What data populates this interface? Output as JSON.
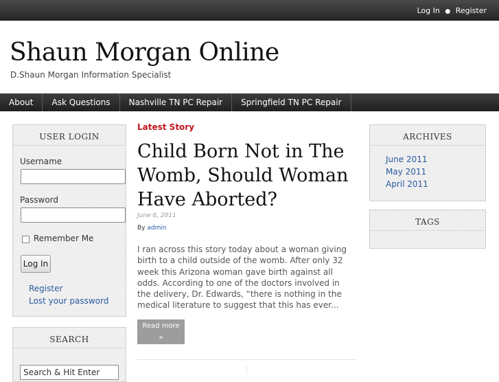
{
  "topbar": {
    "login": "Log In",
    "separator": "●",
    "register": "Register"
  },
  "site": {
    "title": "Shaun Morgan Online",
    "tagline": "D.Shaun Morgan Information Specialist"
  },
  "nav": [
    "About",
    "Ask Questions",
    "Nashville TN PC Repair",
    "Springfield TN PC Repair"
  ],
  "login_widget": {
    "title": "USER LOGIN",
    "username_label": "Username",
    "password_label": "Password",
    "remember_label": "Remember Me",
    "login_button": "Log In",
    "register_link": "Register",
    "lost_password_link": "Lost your password"
  },
  "search_widget": {
    "title": "SEARCH",
    "value": "Search & Hit Enter"
  },
  "post": {
    "section_label": "Latest Story",
    "title": "Child Born Not in The Womb, Should Woman Have Aborted?",
    "date": "June 6, 2011",
    "by_prefix": "By",
    "author": "admin",
    "excerpt": "I ran across this story today about a woman giving birth to a child outside of the womb. After only 32 week this Arizona woman gave birth against all odds. According to one of the doctors involved in the delivery, Dr. Edwards, “there is nothing in the medical literature to suggest that this has ever...",
    "read_more": "Read more",
    "read_more_arrow": "»"
  },
  "archives_widget": {
    "title": "ARCHIVES",
    "items": [
      "June 2011",
      "May 2011",
      "April 2011"
    ]
  },
  "tags_widget": {
    "title": "TAGS"
  },
  "colors": {
    "accent_red": "#c0161c",
    "link_blue": "#2a5aa0"
  }
}
